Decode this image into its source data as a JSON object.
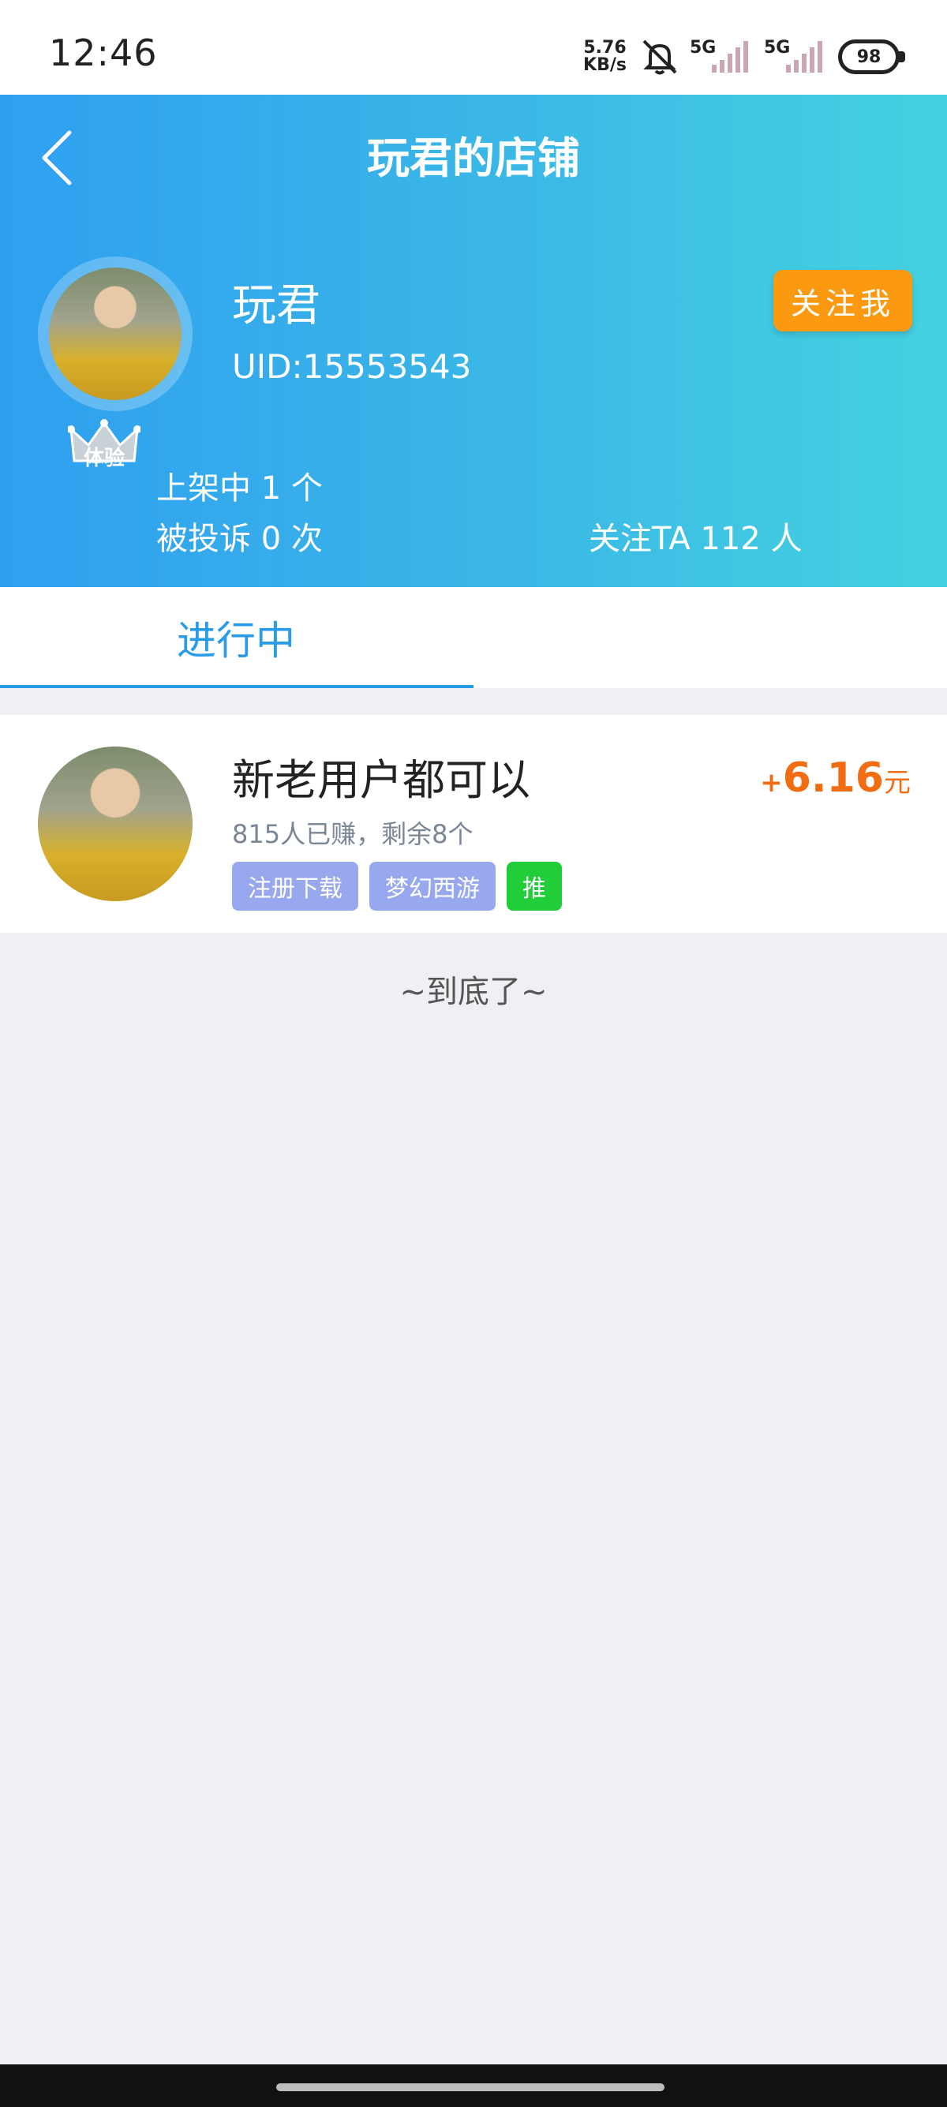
{
  "status_bar": {
    "time": "12:46",
    "net_speed_value": "5.76",
    "net_speed_unit": "KB/s",
    "sim1_label": "5G",
    "sim2_label": "5G",
    "battery": "98",
    "mute_icon": "bell-off-icon"
  },
  "header": {
    "title": "玩君的店铺",
    "back_icon": "chevron-left-icon"
  },
  "profile": {
    "name": "玩君",
    "uid": "UID:15553543",
    "badge": "体验",
    "follow_button": "关注我"
  },
  "stats": {
    "listed": "上架中 1 个",
    "complaints": "被投诉 0 次",
    "followers": "关注TA 112 人"
  },
  "tabs": [
    {
      "label": "进行中",
      "active": true
    }
  ],
  "tasks": [
    {
      "title": "新老用户都可以",
      "reward_sign": "+",
      "reward_amount": "6.16",
      "reward_unit": "元",
      "subtitle": "815人已赚，剩余8个",
      "tags": [
        "注册下载",
        "梦幻西游",
        "推"
      ]
    }
  ],
  "list_end": "~到底了~",
  "colors": {
    "header_gradient_start": "#2f9ff0",
    "header_gradient_end": "#45d2e0",
    "follow_button": "#fb9a11",
    "tab_active": "#2a9be8",
    "reward": "#f26d12",
    "tag_blue": "#98a8ef",
    "tag_green": "#22cd3a"
  }
}
